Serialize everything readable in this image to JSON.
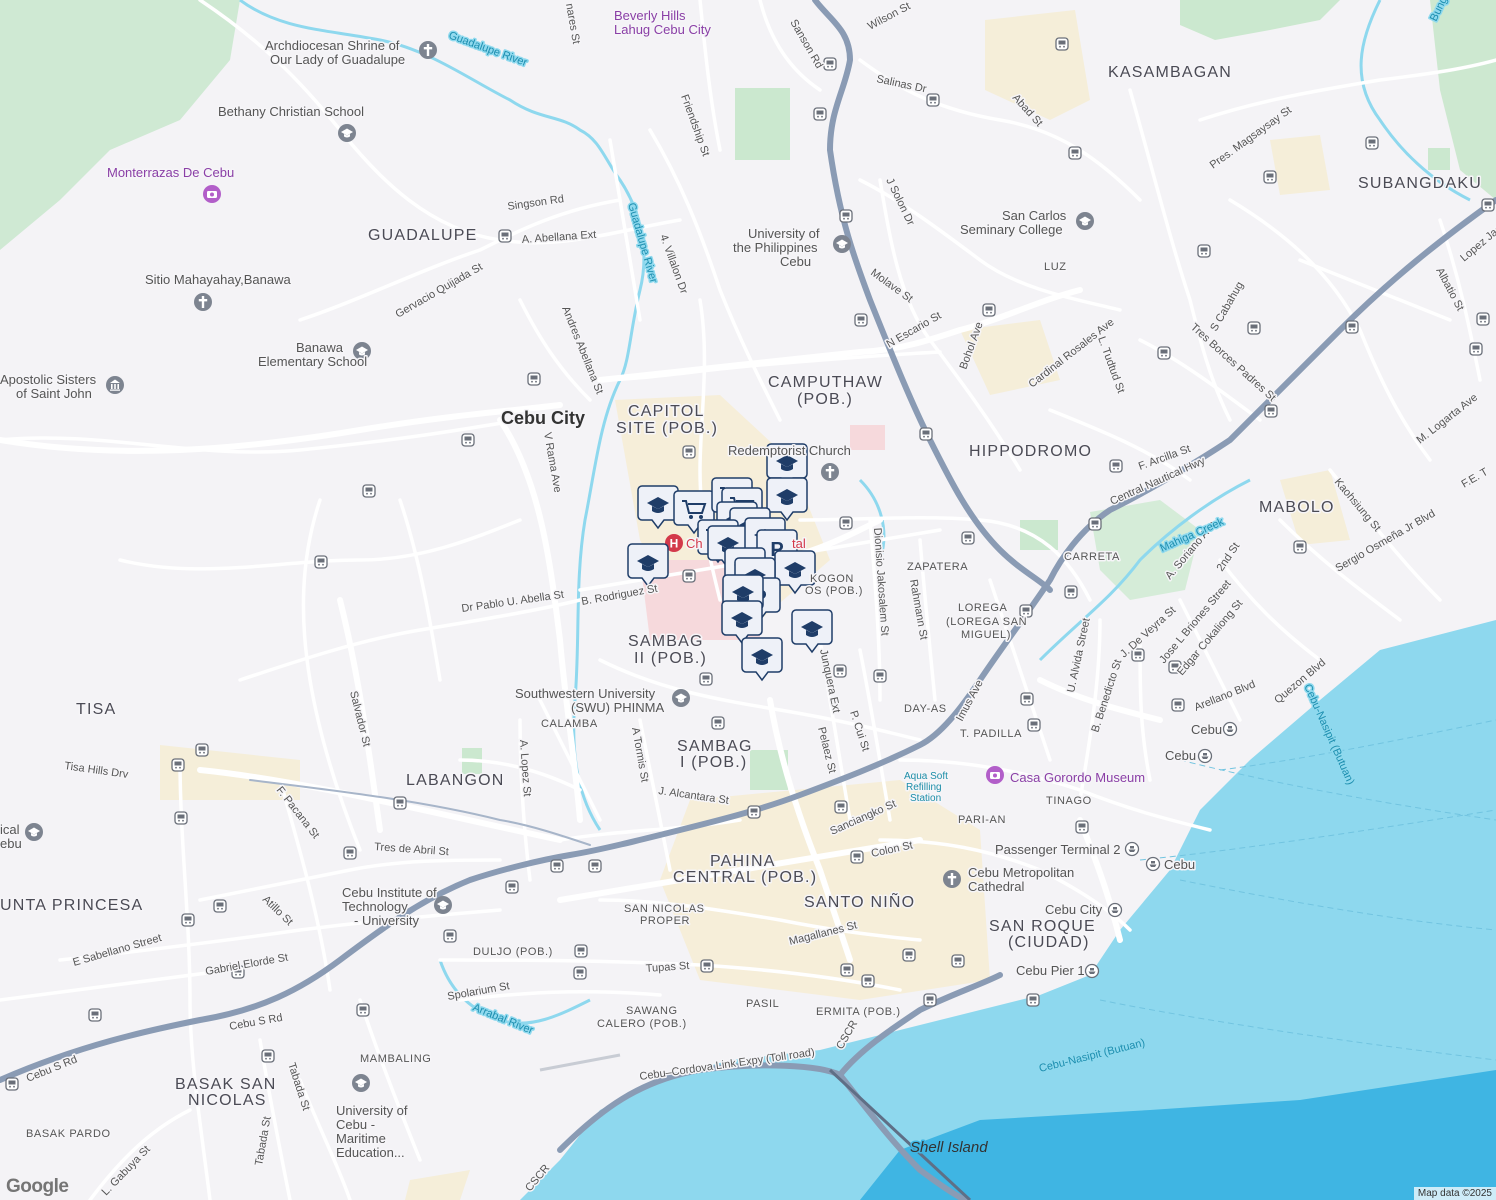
{
  "colors": {
    "land": "#f4f3f6",
    "water": "#8ed8ee",
    "water_deep": "#3fb5e3",
    "park": "#cbe8cf",
    "highway": "#8a9bb4",
    "road": "#ffffff",
    "urban": "#f6edd6",
    "marker": "#1f3d68"
  },
  "attribution": "Map data ©2025",
  "logo_text": "Google",
  "areas": [
    {
      "text": "GUADALUPE",
      "cls": "area"
    },
    {
      "text": "KASAMBAGAN",
      "cls": "area"
    },
    {
      "text": "SUBANGDAKU",
      "cls": "area"
    },
    {
      "text": "CAMPUTHAW",
      "cls": "area"
    },
    {
      "text": "(POB.)",
      "cls": "area"
    },
    {
      "text": "CAPITOL",
      "cls": "area"
    },
    {
      "text": "SITE (POB.)",
      "cls": "area"
    },
    {
      "text": "HIPPODROMO",
      "cls": "area"
    },
    {
      "text": "MABOLO",
      "cls": "area"
    },
    {
      "text": "TISA",
      "cls": "area"
    },
    {
      "text": "LABANGON",
      "cls": "area"
    },
    {
      "text": "SAMBAG",
      "cls": "area"
    },
    {
      "text": "II (POB.)",
      "cls": "area"
    },
    {
      "text": "SAMBAG",
      "cls": "area"
    },
    {
      "text": "I (POB.)",
      "cls": "area"
    },
    {
      "text": "PAHINA",
      "cls": "area"
    },
    {
      "text": "CENTRAL (POB.)",
      "cls": "area"
    },
    {
      "text": "SANTO NIÑO",
      "cls": "area"
    },
    {
      "text": "SAN ROQUE",
      "cls": "area"
    },
    {
      "text": "(CIUDAD)",
      "cls": "area"
    },
    {
      "text": "UNTA PRINCESA",
      "cls": "area"
    },
    {
      "text": "BASAK SAN",
      "cls": "area"
    },
    {
      "text": "NICOLAS",
      "cls": "area"
    },
    {
      "text": "LUZ",
      "cls": "area-sm"
    },
    {
      "text": "CARRETA",
      "cls": "area-sm"
    },
    {
      "text": "ZAPATERA",
      "cls": "area-sm"
    },
    {
      "text": "LOREGA",
      "cls": "area-sm"
    },
    {
      "text": "(LOREGA SAN",
      "cls": "area-sm"
    },
    {
      "text": "MIGUEL)",
      "cls": "area-sm"
    },
    {
      "text": "DAY-AS",
      "cls": "area-sm"
    },
    {
      "text": "T. PADILLA",
      "cls": "area-sm"
    },
    {
      "text": "TINAGO",
      "cls": "area-sm"
    },
    {
      "text": "PARI-AN",
      "cls": "area-sm"
    },
    {
      "text": "CALAMBA",
      "cls": "area-sm"
    },
    {
      "text": "SAN NICOLAS",
      "cls": "area-sm"
    },
    {
      "text": "PROPER",
      "cls": "area-sm"
    },
    {
      "text": "DULJO (POB.)",
      "cls": "area-sm"
    },
    {
      "text": "SAWANG",
      "cls": "area-sm"
    },
    {
      "text": "CALERO (POB.)",
      "cls": "area-sm"
    },
    {
      "text": "PASIL",
      "cls": "area-sm"
    },
    {
      "text": "ERMITA (POB.)",
      "cls": "area-sm"
    },
    {
      "text": "MAMBALING",
      "cls": "area-sm"
    },
    {
      "text": "BASAK PARDO",
      "cls": "area-sm"
    },
    {
      "text": "KOGON",
      "cls": "area-sm"
    },
    {
      "text": "OS (POB.)",
      "cls": "area-sm"
    }
  ],
  "city_label": "Cebu City",
  "pois": [
    {
      "text": "Archdiocesan Shrine of",
      "icon": "church-icon"
    },
    {
      "text": "Our Lady of Guadalupe",
      "icon": ""
    },
    {
      "text": "Bethany Christian School",
      "icon": "school-icon"
    },
    {
      "text": "Sitio Mahayahay,Banawa",
      "icon": "church-icon"
    },
    {
      "text": "Banawa",
      "icon": ""
    },
    {
      "text": "Elementary School",
      "icon": "school-icon"
    },
    {
      "text": "Apostolic Sisters",
      "icon": "museum-icon"
    },
    {
      "text": "of Saint John",
      "icon": ""
    },
    {
      "text": "University of",
      "icon": ""
    },
    {
      "text": "the Philippines",
      "icon": "school-icon"
    },
    {
      "text": "Cebu",
      "icon": ""
    },
    {
      "text": "San Carlos",
      "icon": ""
    },
    {
      "text": "Seminary College",
      "icon": "school-icon"
    },
    {
      "text": "Redemptorist Church",
      "icon": "church-icon"
    },
    {
      "text": "Southwestern University",
      "icon": ""
    },
    {
      "text": "(SWU) PHINMA",
      "icon": "school-icon"
    },
    {
      "text": "Cebu Institute of",
      "icon": ""
    },
    {
      "text": "Technology",
      "icon": "school-icon"
    },
    {
      "text": "- University",
      "icon": ""
    },
    {
      "text": "Cebu Metropolitan",
      "icon": "church-icon"
    },
    {
      "text": "Cathedral",
      "icon": ""
    },
    {
      "text": "University of",
      "icon": ""
    },
    {
      "text": "Cebu -",
      "icon": "school-icon"
    },
    {
      "text": "Maritime",
      "icon": ""
    },
    {
      "text": "Education...",
      "icon": ""
    },
    {
      "text": "ical",
      "icon": ""
    },
    {
      "text": "ebu",
      "icon": "school-icon"
    },
    {
      "text": "Cebu",
      "icon": "ferry-icon"
    },
    {
      "text": "Cebu",
      "icon": "ferry-icon"
    },
    {
      "text": "Passenger Terminal 2",
      "icon": "ferry-icon"
    },
    {
      "text": "Cebu",
      "icon": "ferry-icon"
    },
    {
      "text": "Cebu City",
      "icon": "ferry-icon"
    },
    {
      "text": "Cebu Pier 1",
      "icon": "ferry-icon"
    }
  ],
  "purple_pois": [
    {
      "text": "Beverly Hills",
      "icon": ""
    },
    {
      "text": "Lahug Cebu City",
      "icon": ""
    },
    {
      "text": "Monterrazas De Cebu",
      "icon": "camera-icon"
    },
    {
      "text": "Casa Gorordo Museum",
      "icon": "camera-icon"
    }
  ],
  "blue_pois": [
    {
      "text": "Aqua Soft"
    },
    {
      "text": "Refilling"
    },
    {
      "text": "Station"
    }
  ],
  "hospital": {
    "text": "Chong Hua Hospital",
    "visible_fragment_a": "Ch",
    "visible_fragment_b": "tal"
  },
  "streets": [
    "Salinas Dr",
    "Wilson St",
    "Sanson Rd",
    "Abad St",
    "Friendship St",
    "J Solon Dr",
    "Pres. Magsaysay St",
    "Singson Rd",
    "A. Abellana Ext",
    "4. Villalon Dr",
    "Molave St",
    "Gervacio Quijada St",
    "N Escario St",
    "Bohol Ave",
    "Cardinal Rosales Ave",
    "L. Tudtud St",
    "S Cabahug",
    "Tres Borces Padres St",
    "Albatio St",
    "Lopez Jaena",
    "Andres Abellana St",
    "V Rama Ave",
    "F. Arcilla St",
    "Central Nautical Hwy",
    "Kaohsiung St",
    "M. Logarta Ave",
    "F.E. T",
    "A. Soriano Ave",
    "2nd St",
    "Sergio Osmeña Jr Blvd",
    "Dr Pablo U. Abella St",
    "B. Rodriguez St",
    "Dionisio Jakosalem St",
    "Rahmann St",
    "Imus Ave",
    "J. De Veyra St",
    "Jose L Briones Street",
    "Edgar Cokaliong St",
    "U. Alvida Street",
    "B. Benedicto St",
    "Quezon Blvd",
    "Arellano Blvd",
    "Salvador St",
    "A. Lopez St",
    "A Tormis St",
    "Junquera Ext",
    "Pelaez St",
    "P. Cui St",
    "Tisa Hills Drv",
    "F. Pacana St",
    "J. Alcantara St",
    "Sanciangko St",
    "Colon St",
    "Tres de Abril St",
    "Atillo St",
    "E Sabellano Street",
    "Gabriel Elorde St",
    "Magallanes St",
    "Tupas St",
    "Spolarium St",
    "Cebu S Rd",
    "Cebu S Rd",
    "Tabada St",
    "Tabada St",
    "L. Gabuya St",
    "Cebu–Cordova Link Expy (Toll road)",
    "CSCR",
    "CSCR",
    "nares St"
  ],
  "water_labels": [
    "Guadalupe River",
    "Guadalupe River",
    "Mahiga Creek",
    "Arrabal River",
    "Cebu-Nasipit (Butuan)",
    "Cebu-Nasipit (Butuan)",
    "Shell Island",
    "Bungdaku River"
  ]
}
